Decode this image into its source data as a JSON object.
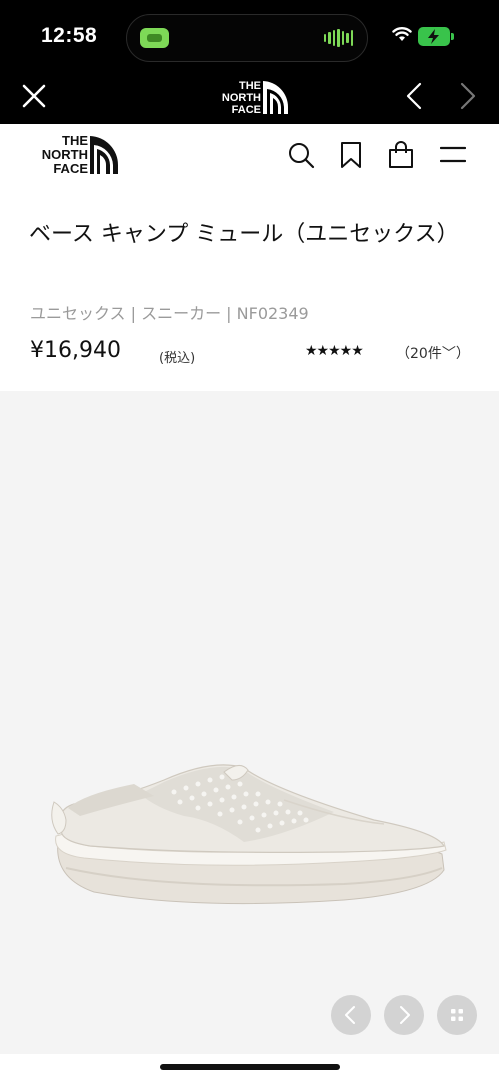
{
  "status_bar": {
    "time": "12:58"
  },
  "app_nav": {
    "logo_line1": "THE",
    "logo_line2": "NORTH",
    "logo_line3": "FACE"
  },
  "site_header": {
    "logo_line1": "THE",
    "logo_line2": "NORTH",
    "logo_line3": "FACE"
  },
  "product": {
    "title": "ベース キャンプ ミュール（ユニセックス）",
    "meta": "ユニセックス | スニーカー | NF02349",
    "price": "¥16,940",
    "tax_note": "(税込)",
    "rating_stars": "★★★★★",
    "rating_value": 4.5,
    "review_count": "（20件﹀）"
  },
  "icons": {
    "close": "close-icon",
    "back": "chevron-left-icon",
    "forward": "chevron-right-icon",
    "search": "search-icon",
    "bookmark": "bookmark-icon",
    "bag": "shopping-bag-icon",
    "menu": "hamburger-menu-icon",
    "gallery_prev": "chevron-left-icon",
    "gallery_next": "chevron-right-icon",
    "gallery_grid": "grid-icon"
  },
  "colors": {
    "bar_background": "#000000",
    "image_background": "#f4f4f4",
    "meta_text": "#9a9a9a",
    "gallery_button": "#d3d3d3",
    "battery": "#39c34b"
  }
}
